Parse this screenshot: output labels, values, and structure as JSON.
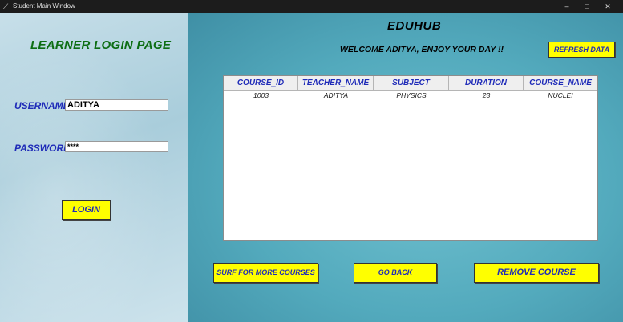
{
  "window": {
    "title": "Student Main Window",
    "app_icon": "feather-icon",
    "controls": [
      "–",
      "□",
      "✕"
    ]
  },
  "login_panel": {
    "heading": "LEARNER LOGIN PAGE",
    "username_label": "USERNAME",
    "username_value": "ADITYA",
    "password_label": "PASSWORD",
    "password_value": "****",
    "login_button": "LOGIN"
  },
  "header": {
    "brand": "EDUHUB",
    "welcome": "WELCOME ADITYA, ENJOY YOUR DAY !!",
    "refresh_button": "REFRESH DATA"
  },
  "table": {
    "columns": [
      "COURSE_ID",
      "TEACHER_NAME",
      "SUBJECT",
      "DURATION",
      "COURSE_NAME"
    ],
    "rows": [
      [
        "1003",
        "ADITYA",
        "PHYSICS",
        "23",
        "NUCLEI"
      ]
    ]
  },
  "actions": {
    "surf_button": "SURF FOR MORE COURSES",
    "go_back_button": "GO BACK",
    "remove_button": "REMOVE COURSE"
  },
  "colors": {
    "button_yellow": "#ffff00",
    "label_blue": "#1f2bb8",
    "heading_green": "#0d6e13"
  }
}
